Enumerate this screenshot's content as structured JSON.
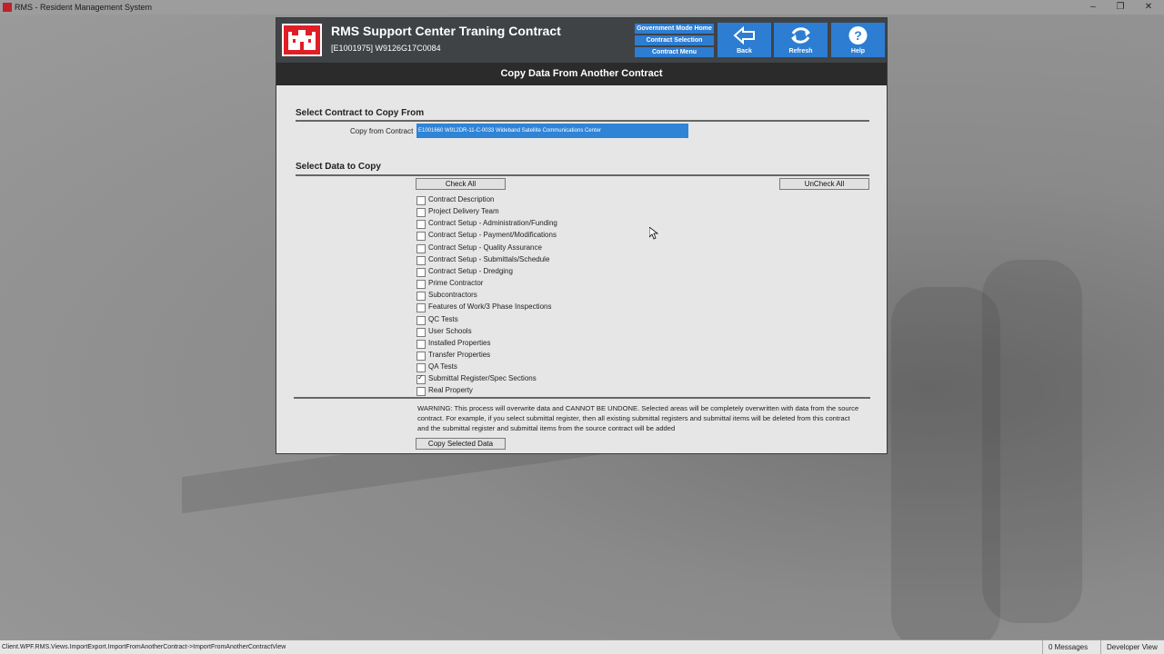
{
  "window": {
    "title": "RMS - Resident Management System",
    "controls": [
      "minimize-icon",
      "restore-icon",
      "close-icon"
    ]
  },
  "header": {
    "title": "RMS Support Center Traning Contract",
    "subtitle": "[E1001975] W9126G17C0084",
    "nav": {
      "government_mode_home": "Government Mode Home",
      "contract_selection": "Contract Selection",
      "contract_menu": "Contract Menu"
    },
    "buttons": {
      "back": "Back",
      "refresh": "Refresh",
      "help": "Help"
    }
  },
  "page_title": "Copy Data From Another Contract",
  "select_contract": {
    "section_title": "Select Contract to Copy From",
    "label": "Copy from Contract",
    "selected_value": "E1001660  W912DR-11-C-0033  Wideband Satellite Communications Center"
  },
  "select_data": {
    "section_title": "Select Data to Copy",
    "check_all": "Check All",
    "uncheck_all": "UnCheck All",
    "items": [
      {
        "label": "Contract Description",
        "checked": false
      },
      {
        "label": "Project Delivery Team",
        "checked": false
      },
      {
        "label": "Contract Setup - Administration/Funding",
        "checked": false
      },
      {
        "label": "Contract Setup - Payment/Modifications",
        "checked": false
      },
      {
        "label": "Contract Setup - Quality Assurance",
        "checked": false
      },
      {
        "label": "Contract Setup - Submittals/Schedule",
        "checked": false
      },
      {
        "label": "Contract Setup - Dredging",
        "checked": false
      },
      {
        "label": "Prime Contractor",
        "checked": false
      },
      {
        "label": "Subcontractors",
        "checked": false
      },
      {
        "label": "Features of Work/3 Phase Inspections",
        "checked": false
      },
      {
        "label": "QC Tests",
        "checked": false
      },
      {
        "label": "User Schools",
        "checked": false
      },
      {
        "label": "Installed Properties",
        "checked": false
      },
      {
        "label": "Transfer Properties",
        "checked": false
      },
      {
        "label": "QA Tests",
        "checked": false
      },
      {
        "label": "Submittal Register/Spec Sections",
        "checked": true
      },
      {
        "label": "Real Property",
        "checked": false
      }
    ]
  },
  "warning": "WARNING: This process will overwrite data and CANNOT BE UNDONE. Selected areas will be completely overwritten with data from the source contract. For example, if you select submittal register, then all existing submittal registers and submittal items will be deleted from this contract and the submittal register and submittal items from the source contract will be added",
  "copy_button": "Copy Selected Data",
  "statusbar": {
    "path": "Client.WPF.RMS.Views.ImportExport.ImportFromAnotherContract->ImportFromAnotherContractView",
    "messages": "0 Messages",
    "view": "Developer View"
  },
  "colors": {
    "accent_blue": "#2d7dd2",
    "header_dark": "#3f4346",
    "logo_red": "#e01e25"
  }
}
